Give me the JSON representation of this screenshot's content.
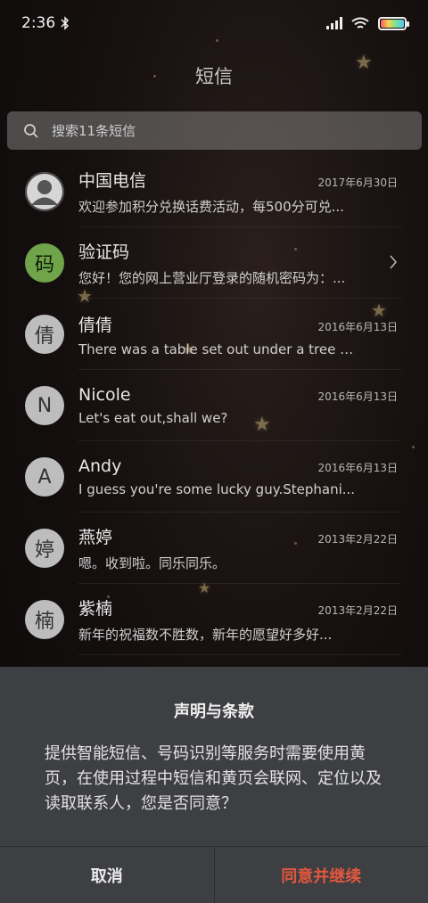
{
  "status": {
    "time": "2:36"
  },
  "header": {
    "title": "短信"
  },
  "search": {
    "placeholder": "搜索11条短信"
  },
  "messages": [
    {
      "name": "中国电信",
      "date": "2017年6月30日",
      "preview": "欢迎参加积分兑换话费活动，每500分可兑...",
      "avatar": ""
    },
    {
      "name": "验证码",
      "date": "",
      "preview": "您好！您的网上营业厅登录的随机密码为：...",
      "avatar": "码"
    },
    {
      "name": "倩倩",
      "date": "2016年6月13日",
      "preview": "There was a table set out under a tree in...",
      "avatar": "倩"
    },
    {
      "name": "Nicole",
      "date": "2016年6月13日",
      "preview": "Let's eat out,shall we?",
      "avatar": "N"
    },
    {
      "name": "Andy",
      "date": "2016年6月13日",
      "preview": "I guess you're some lucky guy.Stephani...",
      "avatar": "A"
    },
    {
      "name": "燕婷",
      "date": "2013年2月22日",
      "preview": "嗯。收到啦。同乐同乐。",
      "avatar": "婷"
    },
    {
      "name": "紫楠",
      "date": "2013年2月22日",
      "preview": "新年的祝福数不胜数，新年的愿望好多好...",
      "avatar": "楠"
    }
  ],
  "dialog": {
    "title": "声明与条款",
    "body": "提供智能短信、号码识别等服务时需要使用黄页，在使用过程中短信和黄页会联网、定位以及读取联系人，您是否同意？",
    "cancel_label": "取消",
    "agree_label": "同意并继续"
  },
  "colors": {
    "agree": "#e3573d",
    "dialog_bg": "#3e3f42",
    "code_avatar": "#6fa44a"
  }
}
